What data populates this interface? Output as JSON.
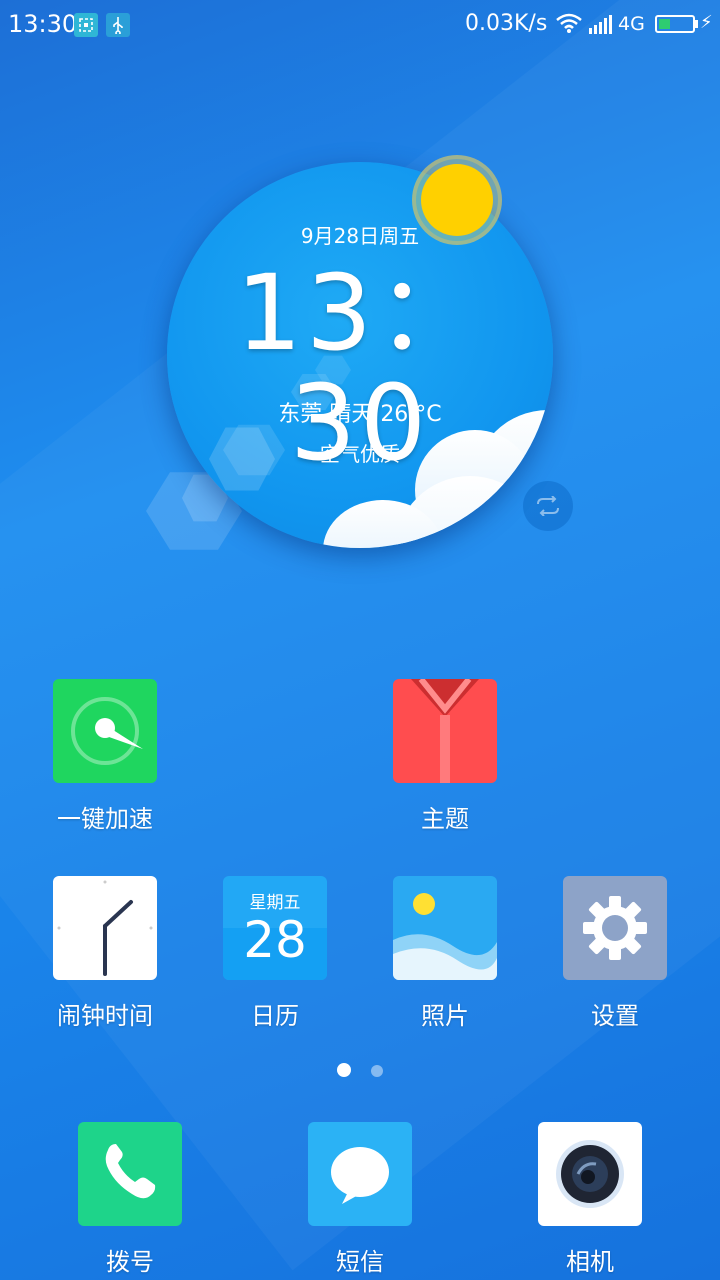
{
  "status_bar": {
    "time": "13:30",
    "net_speed": "0.03K/s",
    "network_type": "4G",
    "battery_level_fraction": 0.35,
    "icons": [
      "screenshot-icon",
      "usb-icon",
      "wifi-icon",
      "signal-icon",
      "battery-icon",
      "charging-icon"
    ]
  },
  "weather_widget": {
    "date": "9月28日周五",
    "time": "13：30",
    "weather": "东莞 晴天 26 °C",
    "air_quality": "空气优质"
  },
  "apps": [
    {
      "label": "一键加速",
      "icon": "boost-icon",
      "color": "#1fd65f"
    },
    {
      "label": "主题",
      "icon": "theme-icon",
      "color": "#ff4d4f"
    },
    {
      "label": "闹钟时间",
      "icon": "clock-icon",
      "color": "#ffffff"
    },
    {
      "label": "日历",
      "icon": "calendar-icon",
      "color": "#22a8f5",
      "weekday": "星期五",
      "day": "28"
    },
    {
      "label": "照片",
      "icon": "photos-icon",
      "color": "#2aa9f2"
    },
    {
      "label": "设置",
      "icon": "settings-icon",
      "color": "#8da3c8"
    }
  ],
  "dock": [
    {
      "label": "拨号",
      "icon": "phone-icon",
      "color": "#1ed48a"
    },
    {
      "label": "短信",
      "icon": "messages-icon",
      "color": "#2bb2f5"
    },
    {
      "label": "相机",
      "icon": "camera-icon",
      "color": "#ffffff"
    }
  ],
  "pager": {
    "page_count": 2,
    "active_page": 1
  }
}
